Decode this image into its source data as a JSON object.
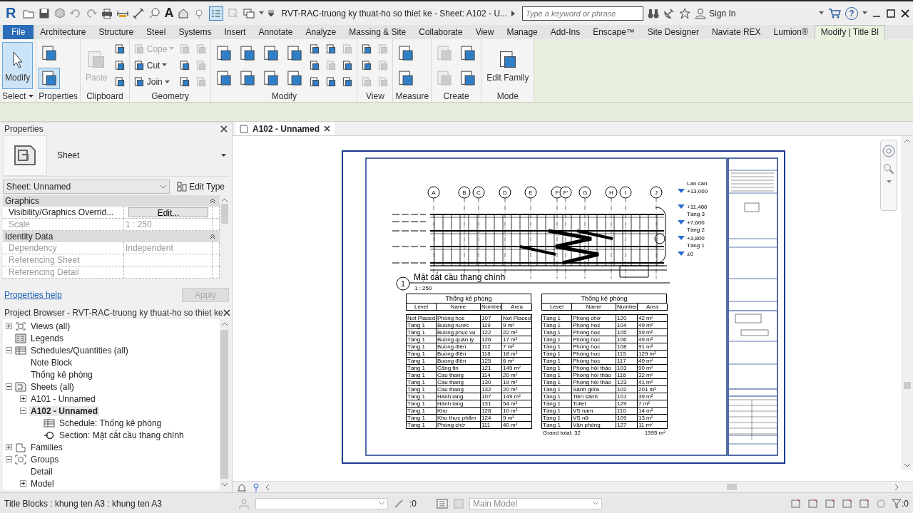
{
  "title_bar": {
    "logo": "R",
    "text_tool": "A",
    "title": "RVT-RAC-truong ky thuat-ho so thiet ke - Sheet: A102 - U...",
    "search": {
      "placeholder": "Type a keyword or phrase"
    },
    "sign_in": "Sign In",
    "help": "?"
  },
  "ribbon_tabs": [
    {
      "label": "File",
      "kind": "file",
      "selected": false
    },
    {
      "label": "Architecture",
      "kind": "tab",
      "selected": false
    },
    {
      "label": "Structure",
      "kind": "tab",
      "selected": false
    },
    {
      "label": "Steel",
      "kind": "tab",
      "selected": false
    },
    {
      "label": "Systems",
      "kind": "tab",
      "selected": false
    },
    {
      "label": "Insert",
      "kind": "tab",
      "selected": false
    },
    {
      "label": "Annotate",
      "kind": "tab",
      "selected": false
    },
    {
      "label": "Analyze",
      "kind": "tab",
      "selected": false
    },
    {
      "label": "Massing & Site",
      "kind": "tab",
      "selected": false
    },
    {
      "label": "Collaborate",
      "kind": "tab",
      "selected": false
    },
    {
      "label": "View",
      "kind": "tab",
      "selected": false
    },
    {
      "label": "Manage",
      "kind": "tab",
      "selected": false
    },
    {
      "label": "Add-Ins",
      "kind": "tab",
      "selected": false
    },
    {
      "label": "Enscape™",
      "kind": "tab",
      "selected": false
    },
    {
      "label": "Site Designer",
      "kind": "tab",
      "selected": false
    },
    {
      "label": "Naviate REX",
      "kind": "tab",
      "selected": false
    },
    {
      "label": "Lumion®",
      "kind": "tab",
      "selected": false
    },
    {
      "label": "Modify | Title Bl",
      "kind": "contextual",
      "selected": true
    }
  ],
  "ribbon_panels": [
    {
      "title": "Select",
      "dropdown": true,
      "columns": [
        [
          {
            "kind": "large",
            "label": "Modify",
            "selected": true,
            "disabled": false
          }
        ]
      ]
    },
    {
      "title": "Properties",
      "dropdown": false,
      "columns": [
        [
          {
            "kind": "medium",
            "selected": false,
            "disabled": false
          },
          {
            "kind": "medium",
            "selected": true,
            "disabled": false
          }
        ]
      ]
    },
    {
      "title": "Clipboard",
      "dropdown": false,
      "columns": [
        [
          {
            "kind": "large",
            "label": "Paste",
            "selected": false,
            "disabled": true
          }
        ],
        [
          {
            "kind": "small",
            "selected": false,
            "disabled": false
          },
          {
            "kind": "small",
            "selected": false,
            "disabled": false
          },
          {
            "kind": "small",
            "selected": false,
            "disabled": false
          }
        ]
      ]
    },
    {
      "title": "Geometry",
      "dropdown": false,
      "columns": [
        [
          {
            "kind": "small",
            "label": "Cope",
            "selected": false,
            "disabled": true
          },
          {
            "kind": "small",
            "label": "Cut",
            "selected": false,
            "disabled": false
          },
          {
            "kind": "small",
            "label": "Join",
            "selected": false,
            "disabled": false
          }
        ],
        [
          {
            "kind": "small",
            "selected": false,
            "disabled": true
          },
          {
            "kind": "small",
            "selected": false,
            "disabled": false
          },
          {
            "kind": "small",
            "selected": false,
            "disabled": false
          }
        ],
        [
          {
            "kind": "small",
            "selected": false,
            "disabled": true
          },
          {
            "kind": "small",
            "selected": false,
            "disabled": true
          },
          {
            "kind": "small",
            "selected": false,
            "disabled": true
          }
        ]
      ]
    },
    {
      "title": "Modify",
      "dropdown": false,
      "columns": [
        [
          {
            "kind": "medium",
            "selected": false,
            "disabled": false
          },
          {
            "kind": "medium",
            "selected": false,
            "disabled": false
          }
        ],
        [
          {
            "kind": "medium",
            "selected": false,
            "disabled": false
          },
          {
            "kind": "medium",
            "selected": false,
            "disabled": false
          }
        ],
        [
          {
            "kind": "medium",
            "selected": false,
            "disabled": false
          },
          {
            "kind": "medium",
            "selected": false,
            "disabled": false
          }
        ],
        [
          {
            "kind": "medium",
            "selected": false,
            "disabled": false
          },
          {
            "kind": "medium",
            "selected": false,
            "disabled": false
          }
        ],
        [
          {
            "kind": "small",
            "selected": false,
            "disabled": false
          },
          {
            "kind": "small",
            "selected": false,
            "disabled": false
          },
          {
            "kind": "small",
            "selected": false,
            "disabled": false
          }
        ],
        [
          {
            "kind": "small",
            "selected": false,
            "disabled": false
          },
          {
            "kind": "small",
            "selected": false,
            "disabled": true
          },
          {
            "kind": "small",
            "selected": false,
            "disabled": false
          }
        ],
        [
          {
            "kind": "small",
            "selected": false,
            "disabled": true
          },
          {
            "kind": "small",
            "selected": false,
            "disabled": false
          },
          {
            "kind": "small",
            "selected": false,
            "disabled": false
          }
        ]
      ]
    },
    {
      "title": "View",
      "dropdown": false,
      "columns": [
        [
          {
            "kind": "small",
            "selected": false,
            "disabled": false
          },
          {
            "kind": "small",
            "selected": false,
            "disabled": false
          },
          {
            "kind": "small",
            "selected": false,
            "disabled": true
          }
        ],
        [
          {
            "kind": "small",
            "selected": false,
            "disabled": true
          },
          {
            "kind": "small",
            "selected": false,
            "disabled": true
          },
          {
            "kind": "small",
            "selected": false,
            "disabled": true
          }
        ]
      ]
    },
    {
      "title": "Measure",
      "dropdown": false,
      "columns": [
        [
          {
            "kind": "medium",
            "selected": false,
            "disabled": false
          },
          {
            "kind": "medium",
            "selected": false,
            "disabled": false
          }
        ]
      ]
    },
    {
      "title": "Create",
      "dropdown": false,
      "columns": [
        [
          {
            "kind": "medium",
            "selected": false,
            "disabled": true
          },
          {
            "kind": "medium",
            "selected": false,
            "disabled": true
          }
        ],
        [
          {
            "kind": "medium",
            "selected": false,
            "disabled": false
          },
          {
            "kind": "medium",
            "selected": false,
            "disabled": false
          }
        ]
      ]
    },
    {
      "title": "Mode",
      "dropdown": false,
      "columns": [
        [
          {
            "kind": "large",
            "label": "Edit Family",
            "selected": false,
            "disabled": false
          }
        ]
      ]
    }
  ],
  "properties": {
    "title": "Properties",
    "type_name": "Sheet",
    "instance_selector": "Sheet: Unnamed",
    "edit_type": "Edit Type",
    "groups": [
      {
        "name": "Graphics",
        "expanded": true,
        "rows": [
          {
            "label": "Visibility/Graphics Overrid...",
            "value": "Edit...",
            "kind": "button",
            "disabled": false
          },
          {
            "label": "Scale",
            "value": "1 : 250",
            "kind": "text",
            "disabled": true
          }
        ]
      },
      {
        "name": "Identity Data",
        "expanded": true,
        "rows": [
          {
            "label": "Dependency",
            "value": "Independent",
            "kind": "text",
            "disabled": true
          },
          {
            "label": "Referencing Sheet",
            "kind": "text",
            "disabled": true
          },
          {
            "label": "Referencing Detail",
            "kind": "text",
            "disabled": true
          }
        ]
      }
    ],
    "help_link": "Properties help",
    "apply": {
      "label": "Apply",
      "disabled": true
    }
  },
  "project_browser": {
    "title": "Project Browser - RVT-RAC-truong ky thuat-ho so thiet ke",
    "tree": [
      {
        "label": "Views (all)",
        "kind": "views",
        "expanded": false,
        "selected": false
      },
      {
        "label": "Legends",
        "kind": "legends",
        "selected": false
      },
      {
        "label": "Schedules/Quantities (all)",
        "kind": "schedules",
        "expanded": true,
        "selected": false,
        "children": [
          {
            "label": "Note Block",
            "selected": false
          },
          {
            "label": "Thống kê phòng",
            "selected": false
          }
        ]
      },
      {
        "label": "Sheets (all)",
        "kind": "sheets",
        "expanded": true,
        "selected": false,
        "children": [
          {
            "label": "A101 - Unnamed",
            "expanded": false,
            "selected": false
          },
          {
            "label": "A102 - Unnamed",
            "expanded": true,
            "selected": true,
            "children": [
              {
                "label": "Schedule: Thống kê phòng",
                "kind": "schedules",
                "selected": false
              },
              {
                "label": "Section: Mặt cắt cầu thang chính",
                "kind": "section",
                "selected": false
              }
            ]
          }
        ]
      },
      {
        "label": "Families",
        "kind": "families",
        "expanded": false,
        "selected": false
      },
      {
        "label": "Groups",
        "kind": "groups",
        "expanded": true,
        "selected": false,
        "children": [
          {
            "label": "Detail",
            "selected": false
          },
          {
            "label": "Model",
            "expanded": false,
            "selected": false
          }
        ]
      }
    ]
  },
  "view_tabs": [
    {
      "label": "A102 - Unnamed",
      "selected": true
    }
  ],
  "sheet": {
    "grid_labels": [
      "A",
      "B",
      "C",
      "D",
      "E",
      "F",
      "F'",
      "G",
      "H",
      "I",
      "J"
    ],
    "level_marks": [
      {
        "name": "Lan can",
        "elevation": "+13,000"
      },
      {
        "name": "Tầng 3",
        "elevation": "+11,400"
      },
      {
        "name": "Tầng 2",
        "elevation": "+7,600"
      },
      {
        "name": "Tầng 1",
        "elevation": "+3,800"
      },
      {
        "elevation": "±0"
      }
    ],
    "view_title": {
      "number": "1",
      "title": "Mặt cắt cầu thang chính",
      "scale": "1 : 250"
    },
    "schedules": [
      {
        "title": "Thống kê phòng",
        "columns": [
          "Level",
          "Name",
          "Number",
          "Area"
        ],
        "rows": [
          [
            "Not Placed",
            "Phòng học",
            "107",
            "Not Placed"
          ],
          [
            "Tầng 1",
            "Buồng nước",
            "119",
            "9 m²"
          ],
          [
            "Tầng 1",
            "Buồng phục vụ",
            "122",
            "22 m²"
          ],
          [
            "Tầng 1",
            "Buồng quản lý",
            "126",
            "17 m²"
          ],
          [
            "Tầng 1",
            "Buồng điện",
            "112",
            "7 m²"
          ],
          [
            "Tầng 1",
            "Buồng điện",
            "118",
            "18 m²"
          ],
          [
            "Tầng 1",
            "Buồng điện",
            "125",
            "6 m²"
          ],
          [
            "Tầng 1",
            "Căng tin",
            "121",
            "149 m²"
          ],
          [
            "Tầng 1",
            "Cầu thang",
            "114",
            "20 m²"
          ],
          [
            "Tầng 1",
            "Cầu thang",
            "130",
            "19 m²"
          ],
          [
            "Tầng 1",
            "Cầu thang",
            "132",
            "20 m²"
          ],
          [
            "Tầng 1",
            "Hành lang",
            "107",
            "149 m²"
          ],
          [
            "Tầng 1",
            "Hành lang",
            "131",
            "54 m²"
          ],
          [
            "Tầng 1",
            "Kho",
            "128",
            "10 m²"
          ],
          [
            "Tầng 1",
            "Kho thực phẩm",
            "124",
            "9 m²"
          ],
          [
            "Tầng 1",
            "Phòng chờ",
            "111",
            "40 m²"
          ]
        ]
      },
      {
        "title": "Thống kê phòng",
        "columns": [
          "Level",
          "Name",
          "Number",
          "Area"
        ],
        "rows": [
          [
            "Tầng 1",
            "Phòng chờ",
            "120",
            "42 m²"
          ],
          [
            "Tầng 1",
            "Phòng học",
            "104",
            "49 m²"
          ],
          [
            "Tầng 1",
            "Phòng học",
            "105",
            "59 m²"
          ],
          [
            "Tầng 1",
            "Phòng học",
            "106",
            "49 m²"
          ],
          [
            "Tầng 1",
            "Phòng học",
            "108",
            "91 m²"
          ],
          [
            "Tầng 1",
            "Phòng học",
            "115",
            "129 m²"
          ],
          [
            "Tầng 1",
            "Phòng học",
            "117",
            "49 m²"
          ],
          [
            "Tầng 1",
            "Phòng hội thảo",
            "103",
            "90 m²"
          ],
          [
            "Tầng 1",
            "Phòng hội thảo",
            "116",
            "32 m²"
          ],
          [
            "Tầng 1",
            "Phòng hội thảo",
            "123",
            "41 m²"
          ],
          [
            "Tầng 1",
            "Sảnh giữa",
            "102",
            "201 m²"
          ],
          [
            "Tầng 1",
            "Tiền sảnh",
            "101",
            "39 m²"
          ],
          [
            "Tầng 1",
            "Toilet",
            "129",
            "7 m²"
          ],
          [
            "Tầng 1",
            "VS nam",
            "110",
            "14 m²"
          ],
          [
            "Tầng 1",
            "VS nữ",
            "109",
            "13 m²"
          ],
          [
            "Tầng 1",
            "Văn phòng",
            "127",
            "11 m²"
          ]
        ],
        "total_label": "Grand total: 32",
        "total_area": "1595 m²"
      }
    ]
  },
  "status_bar": {
    "text": "Title Blocks : khung ten A3 : khung ten A3",
    "warnings": ":0",
    "workset": "Main Model",
    "filters": ":0"
  }
}
